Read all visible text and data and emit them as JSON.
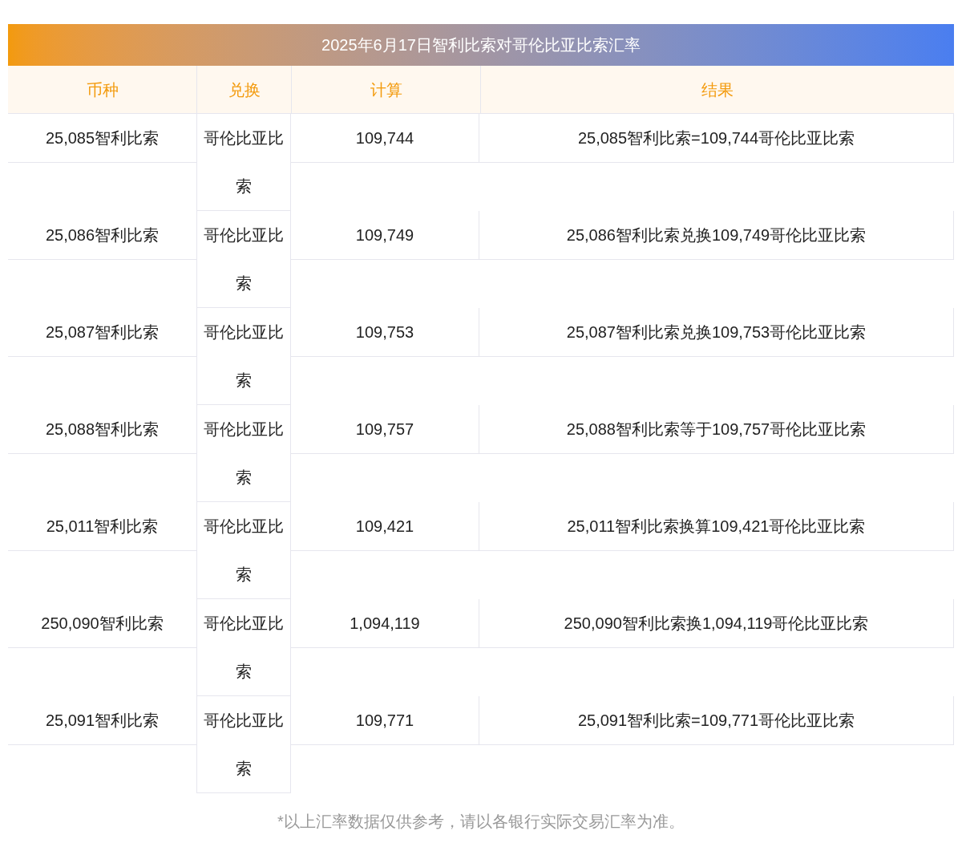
{
  "title": "2025年6月17日智利比索对哥伦比亚比索汇率",
  "columns": [
    "币种",
    "兑换",
    "计算",
    "结果"
  ],
  "rows": [
    {
      "currency": "25,085智利比索",
      "target": "哥伦比亚比索",
      "amount": "109,744",
      "result": "25,085智利比索=109,744哥伦比亚比索"
    },
    {
      "currency": "25,086智利比索",
      "target": "哥伦比亚比索",
      "amount": "109,749",
      "result": "25,086智利比索兑换109,749哥伦比亚比索"
    },
    {
      "currency": "25,087智利比索",
      "target": "哥伦比亚比索",
      "amount": "109,753",
      "result": "25,087智利比索兑换109,753哥伦比亚比索"
    },
    {
      "currency": "25,088智利比索",
      "target": "哥伦比亚比索",
      "amount": "109,757",
      "result": "25,088智利比索等于109,757哥伦比亚比索"
    },
    {
      "currency": "25,011智利比索",
      "target": "哥伦比亚比索",
      "amount": "109,421",
      "result": "25,011智利比索换算109,421哥伦比亚比索"
    },
    {
      "currency": "250,090智利比索",
      "target": "哥伦比亚比索",
      "amount": "1,094,119",
      "result": "250,090智利比索换1,094,119哥伦比亚比索"
    },
    {
      "currency": "25,091智利比索",
      "target": "哥伦比亚比索",
      "amount": "109,771",
      "result": "25,091智利比索=109,771哥伦比亚比索"
    }
  ],
  "footnote": "*以上汇率数据仅供参考，请以各银行实际交易汇率为准。"
}
